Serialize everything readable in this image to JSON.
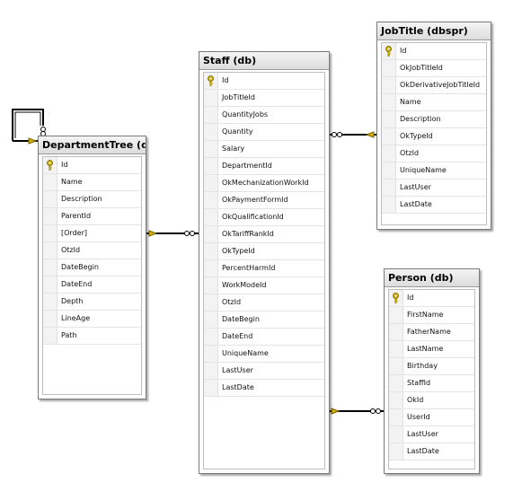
{
  "tables": [
    {
      "title": "DepartmentTree (db)",
      "columns": [
        "Id",
        "Name",
        "Description",
        "ParentId",
        "[Order]",
        "OtzId",
        "DateBegin",
        "DateEnd",
        "Depth",
        "LineAge",
        "Path"
      ]
    },
    {
      "title": "Staff (db)",
      "columns": [
        "Id",
        "JobTitleId",
        "QuantityJobs",
        "Quantity",
        "Salary",
        "DepartmentId",
        "OkMechanizationWorkId",
        "OkPaymentFormId",
        "OkQualificationId",
        "OkTariffRankId",
        "OkTypeId",
        "PercentHarmId",
        "WorkModeId",
        "OtzId",
        "DateBegin",
        "DateEnd",
        "UniqueName",
        "LastUser",
        "LastDate"
      ]
    },
    {
      "title": "JobTitle (dbspr)",
      "columns": [
        "Id",
        "OkJobTitleId",
        "OkDerivativeJobTitleId",
        "Name",
        "Description",
        "OkTypeId",
        "OtzId",
        "UniqueName",
        "LastUser",
        "LastDate"
      ]
    },
    {
      "title": "Person (db)",
      "columns": [
        "Id",
        "FirstName",
        "FatherName",
        "LastName",
        "Birthday",
        "StaffId",
        "OkId",
        "UserId",
        "LastUser",
        "LastDate"
      ]
    }
  ],
  "colors": {
    "key": "#d4b400",
    "line": "#000000"
  }
}
